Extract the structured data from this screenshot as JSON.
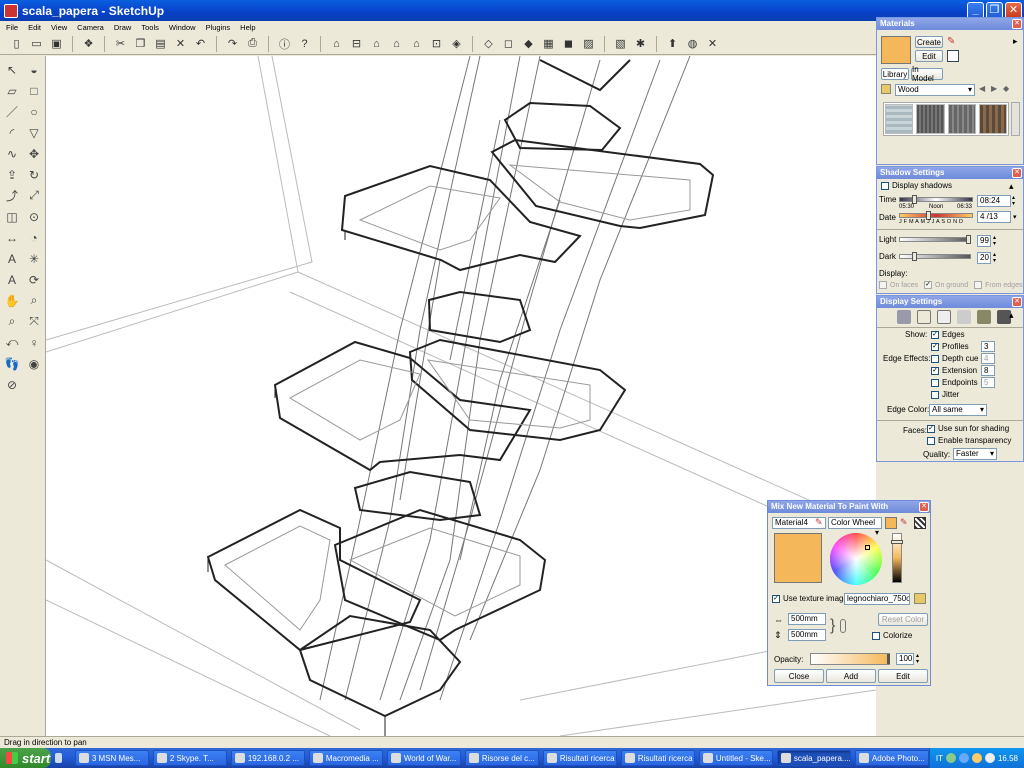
{
  "window": {
    "title": "scala_papera - SketchUp"
  },
  "menu": [
    "File",
    "Edit",
    "View",
    "Camera",
    "Draw",
    "Tools",
    "Window",
    "Plugins",
    "Help"
  ],
  "toolbar_icons": [
    "new-file-icon",
    "open-folder-icon",
    "save-icon",
    "make-component-icon",
    "cut-icon",
    "copy-icon",
    "paste-icon",
    "erase-icon",
    "undo-icon",
    "redo-icon",
    "print-icon",
    "model-info-icon",
    "help-icon",
    "iso-view-icon",
    "top-view-icon",
    "front-view-icon",
    "right-view-icon",
    "back-view-icon",
    "left-view-icon",
    "xray-icon",
    "wireframe-icon",
    "hidden-line-icon",
    "shaded-icon",
    "shaded-textures-icon",
    "monochrome-icon",
    "display-shadows-icon",
    "display-fog-icon",
    "get-models-icon",
    "share-model-icon",
    "google-earth-icon",
    "photo-texture-icon"
  ],
  "left_tools": [
    "select-icon",
    "paint-bucket-icon",
    "eraser-icon",
    "rectangle-icon",
    "line-icon",
    "circle-icon",
    "arc-icon",
    "polygon-icon",
    "freehand-icon",
    "move-icon",
    "push-pull-icon",
    "rotate-icon",
    "follow-me-icon",
    "scale-icon",
    "offset-icon",
    "tape-measure-icon",
    "dimension-icon",
    "protractor-icon",
    "text-icon",
    "axes-icon",
    "3d-text-icon",
    "orbit-icon",
    "pan-icon",
    "zoom-icon",
    "zoom-window-icon",
    "zoom-extents-icon",
    "previous-view-icon",
    "position-camera-icon",
    "walk-icon",
    "look-around-icon",
    "section-plane-icon"
  ],
  "status": {
    "text": "Drag in direction to pan"
  },
  "taskbar": {
    "start_label": "start",
    "tasks": [
      "3 MSN Mes...",
      "2 Skype. T...",
      "192.168.0.2 ...",
      "Macromedia ...",
      "World of War...",
      "Risorse del c...",
      "Risultati ricerca",
      "Risultati ricerca",
      "Untitled - Ske...",
      "scala_papera....",
      "Adobe Photo..."
    ],
    "active_index": 9,
    "language": "IT",
    "clock": "16.58"
  },
  "materials": {
    "title": "Materials",
    "create_label": "Create",
    "edit_label": "Edit",
    "tabs": [
      "Library",
      "In Model"
    ],
    "collection": "Wood",
    "color": "#f4b85a"
  },
  "shadow": {
    "title": "Shadow Settings",
    "display_shadows": "Display shadows",
    "time_label": "Time",
    "time_start": "05:30",
    "time_noon": "Noon",
    "time_end": "06:33",
    "time_value": "08:24",
    "date_label": "Date",
    "months": "J F M A M J J A S O N D",
    "date_value": "4 /13",
    "light_label": "Light",
    "light_value": "99",
    "light_level": 0.97,
    "dark_label": "Dark",
    "dark_value": "20",
    "dark_level": 0.18,
    "display_label": "Display:",
    "on_faces": "On faces",
    "on_ground": "On ground",
    "from_edges": "From edges"
  },
  "display": {
    "title": "Display Settings",
    "show_label": "Show:",
    "edges": "Edges",
    "edge_effects_label": "Edge Effects:",
    "profiles": "Profiles",
    "profiles_value": "3",
    "depth_cue": "Depth cue",
    "depth_value": "4",
    "extension": "Extension",
    "extension_value": "8",
    "endpoints": "Endpoints",
    "endpoints_value": "5",
    "jitter": "Jitter",
    "edge_color_label": "Edge Color:",
    "edge_color": "All same",
    "faces_label": "Faces:",
    "use_sun": "Use sun for shading",
    "enable_transparency": "Enable transparency",
    "quality_label": "Quality:",
    "quality": "Faster"
  },
  "mix": {
    "title": "Mix New Material To Paint With",
    "name": "Material4",
    "picker": "Color Wheel",
    "color": "#f4b85a",
    "use_texture": "Use texture image",
    "texture_file": "legnochiaro_750o.jp",
    "width": "500mm",
    "height": "500mm",
    "reset_color": "Reset Color",
    "colorize": "Colorize",
    "opacity_label": "Opacity:",
    "opacity_value": "100",
    "opacity_level": 1.0,
    "close_label": "Close",
    "add_label": "Add",
    "edit_label": "Edit"
  }
}
